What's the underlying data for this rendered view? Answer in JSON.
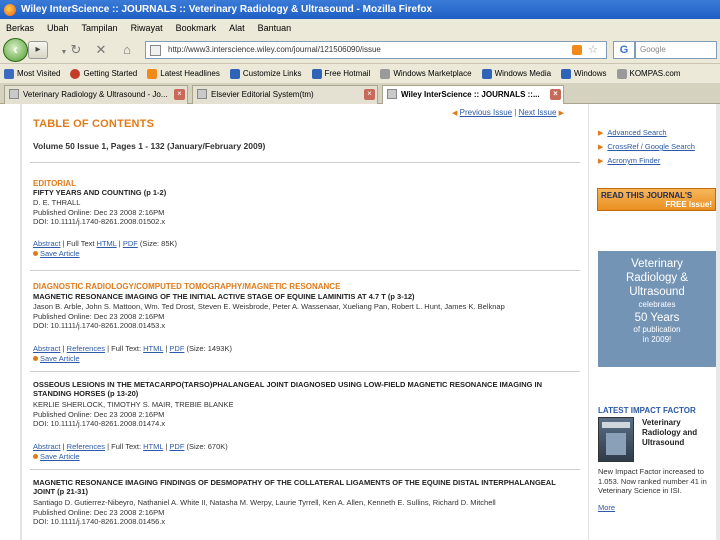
{
  "window": {
    "title": "Wiley InterScience :: JOURNALS :: Veterinary Radiology & Ultrasound - Mozilla Firefox"
  },
  "menu": [
    "Berkas",
    "Ubah",
    "Tampilan",
    "Riwayat",
    "Bookmark",
    "Alat",
    "Bantuan"
  ],
  "nav": {
    "url": "http://www3.interscience.wiley.com/journal/121506090/issue",
    "search_engine": "G",
    "search_placeholder": "Google"
  },
  "bookmarks": [
    {
      "label": "Most Visited",
      "icon": "most-visited-icon",
      "color": "#3d6bbf"
    },
    {
      "label": "Getting Started",
      "icon": "getting-started-icon",
      "color": "#c43b2a"
    },
    {
      "label": "Latest Headlines",
      "icon": "rss-icon",
      "color": "#f28a1a"
    },
    {
      "label": "Customize Links",
      "icon": "msn-icon",
      "color": "#2f63b8"
    },
    {
      "label": "Free Hotmail",
      "icon": "msn-icon",
      "color": "#2f63b8"
    },
    {
      "label": "Windows Marketplace",
      "icon": "page-icon",
      "color": "#9a9a9a"
    },
    {
      "label": "Windows Media",
      "icon": "msn-icon",
      "color": "#2f63b8"
    },
    {
      "label": "Windows",
      "icon": "msn-icon",
      "color": "#2f63b8"
    },
    {
      "label": "KOMPAS.com",
      "icon": "page-icon",
      "color": "#9a9a9a"
    }
  ],
  "tabs": [
    {
      "label": "Veterinary Radiology & Ultrasound - Jo...",
      "active": false
    },
    {
      "label": "Elsevier Editorial System(tm)",
      "active": false
    },
    {
      "label": "Wiley InterScience :: JOURNALS ::...",
      "active": true
    }
  ],
  "page": {
    "prev_issue": "Previous Issue",
    "separator": "|",
    "next_issue": "Next Issue",
    "toc_title": "TABLE OF CONTENTS",
    "volume_line": "Volume 50 Issue 1, Pages 1 - 132 (January/February 2009)",
    "sections": [
      {
        "heading": "EDITORIAL",
        "articles": [
          {
            "title": "FIFTY YEARS AND COUNTING (p 1-2)",
            "authors": "D. E. THRALL",
            "published": "Published Online: Dec 23 2008 2:16PM",
            "doi": "DOI: 10.1111/j.1740-8261.2008.01502.x",
            "links": {
              "abstract": "Abstract",
              "references": "",
              "fulltext": "Full Text",
              "html": "HTML",
              "pdf": "PDF",
              "pdf_size": "(Size: 85K)"
            },
            "save": "Save Article"
          }
        ]
      },
      {
        "heading": "DIAGNOSTIC RADIOLOGY/COMPUTED TOMOGRAPHY/MAGNETIC RESONANCE",
        "articles": [
          {
            "title": "MAGNETIC RESONANCE IMAGING OF THE INITIAL ACTIVE STAGE OF EQUINE LAMINITIS AT 4.7 T (p 3-12)",
            "authors": "Jason B. Arble, John S. Mattoon, Wm. Ted Drost, Steven E. Weisbrode, Peter A. Wassenaar, Xueliang Pan, Robert L. Hunt, James K. Belknap",
            "published": "Published Online: Dec 23 2008 2:16PM",
            "doi": "DOI: 10.1111/j.1740-8261.2008.01453.x",
            "links": {
              "abstract": "Abstract",
              "references": "References",
              "fulltext": "Full Text:",
              "html": "HTML",
              "pdf": "PDF",
              "pdf_size": "(Size: 1493K)"
            },
            "save": "Save Article"
          },
          {
            "title": "OSSEOUS LESIONS IN THE METACARPO(TARSO)PHALANGEAL JOINT DIAGNOSED USING LOW-FIELD MAGNETIC RESONANCE IMAGING IN STANDING HORSES (p 13-20)",
            "authors": "KERLIE SHERLOCK, TIMOTHY S. MAIR, TREBIE BLANKE",
            "published": "Published Online: Dec 23 2008 2:16PM",
            "doi": "DOI: 10.1111/j.1740-8261.2008.01474.x",
            "links": {
              "abstract": "Abstract",
              "references": "References",
              "fulltext": "Full Text:",
              "html": "HTML",
              "pdf": "PDF",
              "pdf_size": "(Size: 670K)"
            },
            "save": "Save Article"
          },
          {
            "title": "MAGNETIC RESONANCE IMAGING FINDINGS OF DESMOPATHY OF THE COLLATERAL LIGAMENTS OF THE EQUINE DISTAL INTERPHALANGEAL JOINT (p 21-31)",
            "authors": "Santiago D. Gutierrez-Nibeyro, Nathaniel A. White II, Natasha M. Werpy, Laurie Tyrrell, Ken A. Allen, Kenneth E. Sullins, Richard D. Mitchell",
            "published": "Published Online: Dec 23 2008 2:16PM",
            "doi": "DOI: 10.1111/j.1740-8261.2008.01456.x"
          }
        ]
      }
    ]
  },
  "sidebar": {
    "links": [
      "Advanced Search",
      "CrossRef / Google Search",
      "Acronym Finder"
    ],
    "free_banner_line1": "READ THIS JOURNAL'S",
    "free_banner_line2": "FREE Issue!",
    "ad": {
      "line1": "Veterinary",
      "line2": "Radiology &",
      "line3": "Ultrasound",
      "line4": "celebrates",
      "line5": "50 Years",
      "line6": "of publication",
      "line7": "in 2009!"
    },
    "impact_heading": "LATEST IMPACT FACTOR",
    "impact_journal": "Veterinary Radiology and Ultrasound",
    "impact_text": "New Impact Factor increased to 1.053. Now ranked number 41 in Veterinary Science in ISI.",
    "more": "More"
  },
  "colors": {
    "accent_orange": "#e07b1a",
    "link_blue": "#2c5aa8",
    "ad_blue": "#7394b5"
  }
}
